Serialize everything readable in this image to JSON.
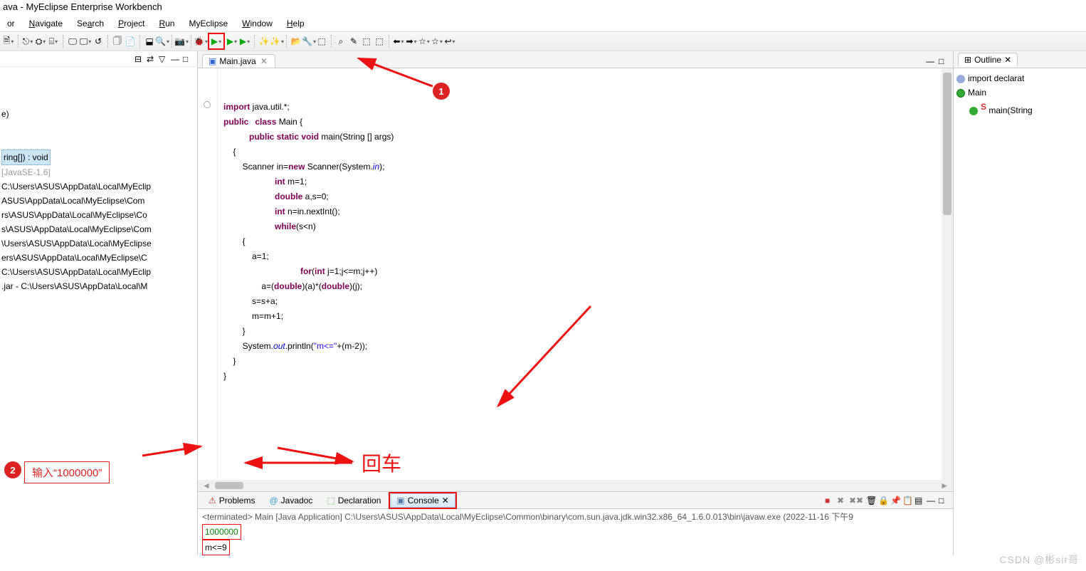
{
  "title": "ava - MyEclipse Enterprise Workbench",
  "menu": {
    "edit": "or",
    "navigate": "Navigate",
    "search": "Search",
    "project": "Project",
    "run": "Run",
    "myeclipse": "MyEclipse",
    "window": "Window",
    "help": "Help"
  },
  "left_panel": {
    "text1": "e)",
    "sel": "ring[]) : void",
    "jre": " [JavaSE-1.6]",
    "paths": [
      "C:\\Users\\ASUS\\AppData\\Local\\MyEclip",
      "ASUS\\AppData\\Local\\MyEclipse\\Com",
      "rs\\ASUS\\AppData\\Local\\MyEclipse\\Co",
      "s\\ASUS\\AppData\\Local\\MyEclipse\\Com",
      "\\Users\\ASUS\\AppData\\Local\\MyEclipse",
      "ers\\ASUS\\AppData\\Local\\MyEclipse\\C",
      "C:\\Users\\ASUS\\AppData\\Local\\MyEclip",
      ".jar - C:\\Users\\ASUS\\AppData\\Local\\M"
    ]
  },
  "editor": {
    "tab_label": "Main.java",
    "code": {
      "l1": {
        "kw": "import",
        "rest": " java.util.*;"
      },
      "l2": {
        "kw1": "public",
        "kw2": "class",
        "rest": " Main {"
      },
      "l3": {
        "kw": "public static void",
        "rest": " main(String [] args)"
      },
      "l4": "    {",
      "l5": {
        "pre": "        Scanner in=",
        "kw": "new",
        "post": " Scanner(System.",
        "it": "in",
        "end": ");"
      },
      "l6": {
        "kw": "int",
        "rest": " m=1;"
      },
      "l7": {
        "kw": "double",
        "rest": " a,s=0;"
      },
      "l8": {
        "kw": "int",
        "rest": " n=in.nextInt();"
      },
      "l9": {
        "kw": "while",
        "rest": "(s<n)"
      },
      "l10": "        {",
      "l11": "            a=1;",
      "l12": {
        "kw1": "for",
        "mid": "(",
        "kw2": "int",
        "rest": " j=1;j<=m;j++)"
      },
      "l13": {
        "pre": "                a=(",
        "kw1": "double",
        "mid": ")(a)*(",
        "kw2": "double",
        "end": ")(j);"
      },
      "l14": "            s=s+a;",
      "l15": "            m=m+1;",
      "l16": "        }",
      "l17": {
        "pre": "        System.",
        "it": "out",
        "mid": ".println(",
        "str": "\"m<=\"",
        "end": "+(m-2));"
      },
      "l18": "    }",
      "l19": "}"
    }
  },
  "bottom": {
    "tabs": {
      "problems": "Problems",
      "javadoc": "Javadoc",
      "declaration": "Declaration",
      "console": "Console"
    },
    "status": "<terminated> Main [Java Application] C:\\Users\\ASUS\\AppData\\Local\\MyEclipse\\Common\\binary\\com.sun.java.jdk.win32.x86_64_1.6.0.013\\bin\\javaw.exe (2022-11-16 下午9",
    "input": "1000000",
    "output": "m<=9"
  },
  "outline": {
    "title": "Outline",
    "items": {
      "imports": "import declarat",
      "class": "Main",
      "method": "main(String"
    }
  },
  "annotations": {
    "badge1": "1",
    "badge2": "2",
    "box2": "输入“1000000”",
    "enter_text": "回车"
  },
  "watermark": "CSDN @彬sir哥"
}
